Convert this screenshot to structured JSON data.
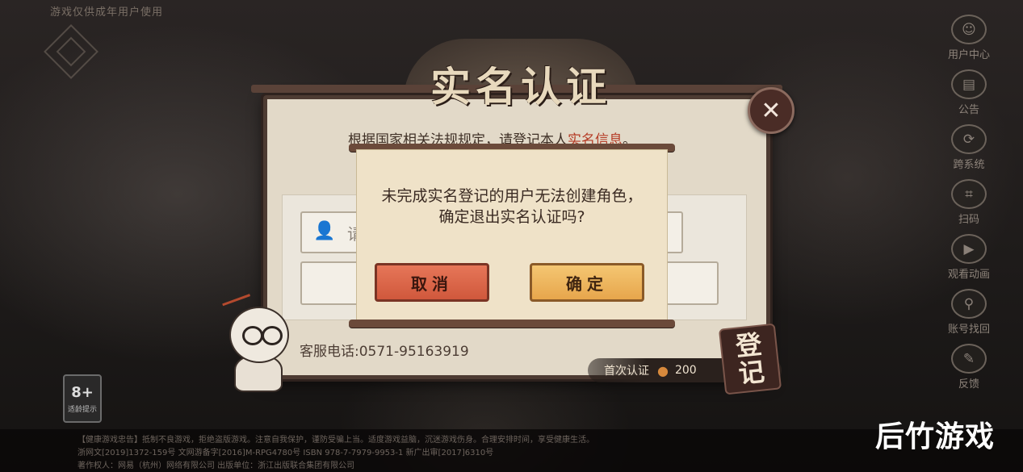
{
  "top_notice": "游戏仅供成年用户使用",
  "dialog": {
    "title": "实名认证",
    "instruction_prefix": "根据国家相关法规规定，请登记本人",
    "instruction_highlight": "实名信息",
    "instruction_suffix": "。",
    "name_placeholder": "请",
    "hotline": "客服电话:0571-95163919"
  },
  "popup": {
    "message": "未完成实名登记的用户无法创建角色，确定退出实名认证吗?",
    "cancel_label": "取消",
    "confirm_label": "确定"
  },
  "first_verify": {
    "label": "首次认证",
    "reward": "200"
  },
  "register_button": {
    "line1": "登",
    "line2": "记"
  },
  "side_menu": [
    {
      "label": "用户中心",
      "icon": "user-center-icon",
      "glyph": "☺"
    },
    {
      "label": "公告",
      "icon": "announcement-icon",
      "glyph": "▤"
    },
    {
      "label": "跨系统",
      "icon": "cross-system-icon",
      "glyph": "⟳"
    },
    {
      "label": "扫码",
      "icon": "scan-icon",
      "glyph": "⌗"
    },
    {
      "label": "观看动画",
      "icon": "film-icon",
      "glyph": "▶"
    },
    {
      "label": "账号找回",
      "icon": "account-recover-icon",
      "glyph": "⚲"
    },
    {
      "label": "反馈",
      "icon": "feedback-icon",
      "glyph": "✎"
    }
  ],
  "age_rating": {
    "number": "8+",
    "text": "适龄提示"
  },
  "footer": {
    "line1": "【健康游戏忠告】抵制不良游戏，拒绝盗版游戏。注意自我保护，谨防受骗上当。适度游戏益脑，沉迷游戏伤身。合理安排时间，享受健康生活。",
    "line2": "浙网文[2019]1372-159号  文网游备字[2016]M-RPG4780号  ISBN 978-7-7979-9953-1  新广出审[2017]6310号",
    "line3": "著作权人：网易（杭州）网络有限公司  出版单位：浙江出版联合集团有限公司"
  },
  "watermark": "后竹游戏"
}
